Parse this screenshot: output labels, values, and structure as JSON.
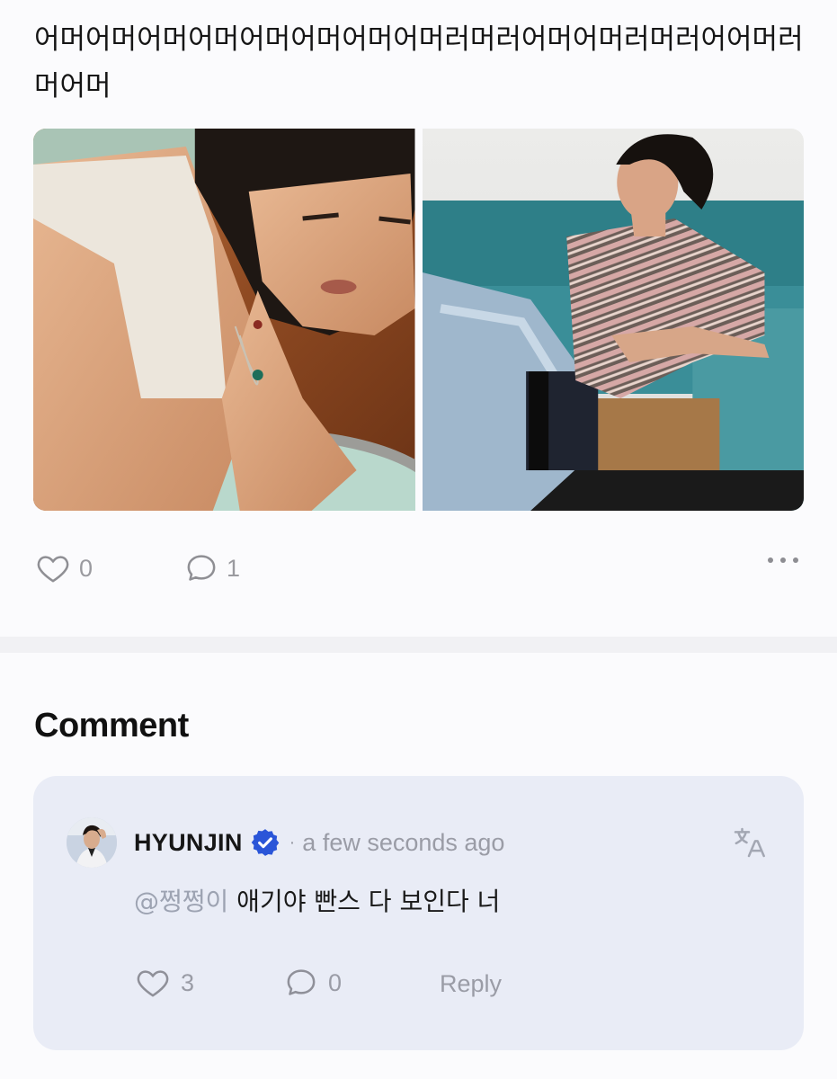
{
  "post": {
    "text": "어머어머어머어머어머어머어머어머러머러어머어머러머러어어머러머어머",
    "images": [
      {
        "description_icon": "photo-icon"
      },
      {
        "description_icon": "photo-icon"
      }
    ],
    "actions": {
      "like_count": "0",
      "comment_count": "1"
    }
  },
  "comments_section": {
    "heading": "Comment",
    "comments": [
      {
        "author": "HYUNJIN",
        "verified": true,
        "separator": "·",
        "time": "a few seconds ago",
        "mention": "@쩡쩡이",
        "text": " 애기야 빤스 다 보인다 너",
        "like_count": "3",
        "reply_count": "0",
        "reply_label": "Reply"
      }
    ]
  },
  "colors": {
    "background": "#fbfbfd",
    "card": "#e9ecf6",
    "verified_badge": "#2a55d8",
    "muted": "#9a9ca6"
  }
}
